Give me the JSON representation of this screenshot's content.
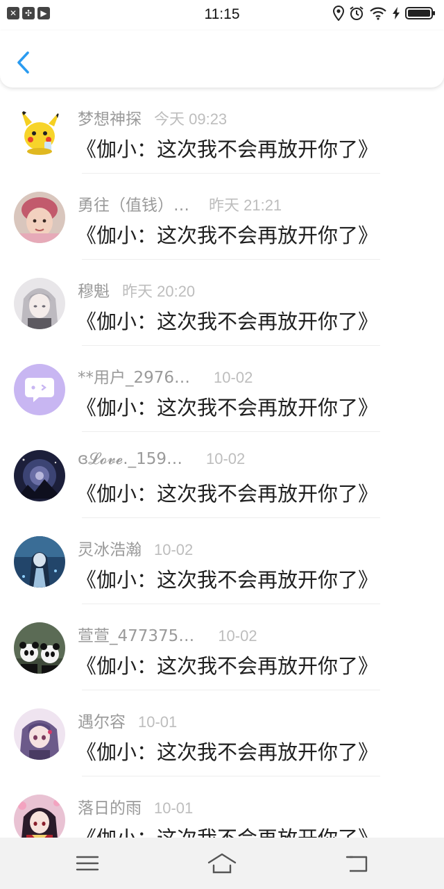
{
  "status_bar": {
    "time": "11:15",
    "left_icons": [
      "close-box-icon",
      "pinwheel-icon",
      "play-icon"
    ],
    "right_icons": [
      "location-icon",
      "alarm-icon",
      "wifi-icon",
      "charging-icon",
      "battery-icon"
    ]
  },
  "nav": {
    "back_icon": "chevron-left-icon",
    "accent": "#2a9bf0"
  },
  "list": {
    "items": [
      {
        "name": "梦想神探",
        "time": "今天 09:23",
        "title": "《伽小：这次我不会再放开你了》",
        "avatar": "pikachu-avatar"
      },
      {
        "name": "勇往（值钱）…",
        "time": "昨天 21:21",
        "title": "《伽小：这次我不会再放开你了》",
        "avatar": "baby-pink-hat-avatar"
      },
      {
        "name": "穆魁",
        "time": "昨天 20:20",
        "title": "《伽小：这次我不会再放开你了》",
        "avatar": "anime-white-hair-avatar"
      },
      {
        "name": "**用户_2976…",
        "time": "10-02",
        "title": "《伽小：这次我不会再放开你了》",
        "avatar": "chat-bubble-default-avatar"
      },
      {
        "name": "ɞ𝓛𝓸𝓿𝓮._159…",
        "time": "10-02",
        "title": "《伽小：这次我不会再放开你了》",
        "avatar": "dark-night-avatar"
      },
      {
        "name": "灵冰浩瀚",
        "time": "10-02",
        "title": "《伽小：这次我不会再放开你了》",
        "avatar": "blue-anime-girl-avatar"
      },
      {
        "name": "萱萱_477375…",
        "time": "10-02",
        "title": "《伽小：这次我不会再放开你了》",
        "avatar": "pandas-avatar"
      },
      {
        "name": "遇尔容",
        "time": "10-01",
        "title": "《伽小：这次我不会再放开你了》",
        "avatar": "purple-anime-girl-avatar"
      },
      {
        "name": "落日的雨",
        "time": "10-01",
        "title": "《伽小：这次我不会再放开你了》",
        "avatar": "red-anime-girl-avatar"
      }
    ]
  },
  "bottom_bar": {
    "icons": [
      "menu-icon",
      "home-icon",
      "back-icon"
    ]
  }
}
